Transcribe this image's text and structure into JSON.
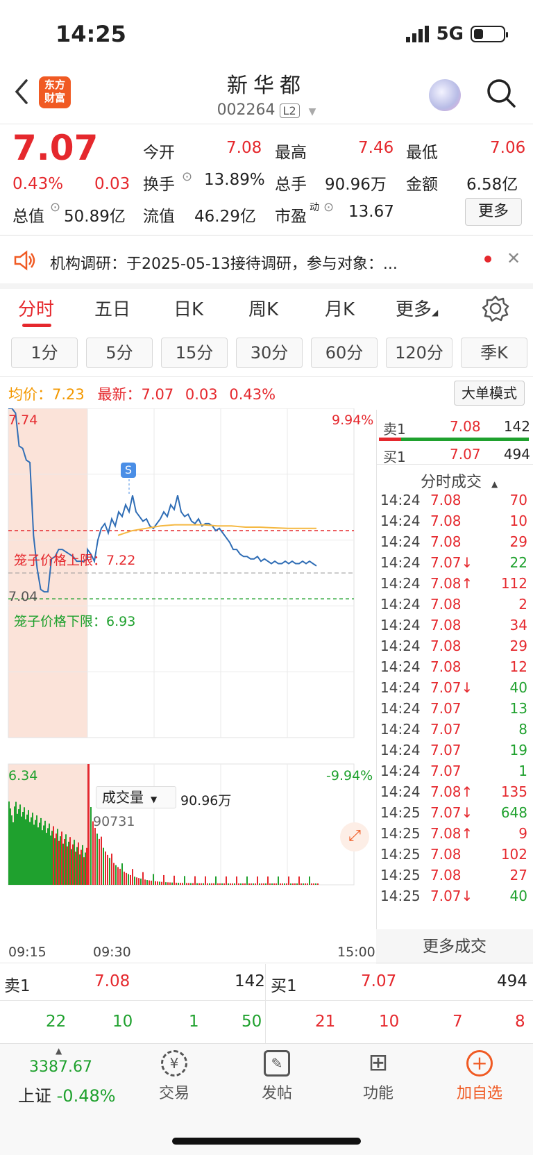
{
  "status_bar": {
    "time": "14:25",
    "network": "5G",
    "battery_level": 0.3
  },
  "header": {
    "title": "新华都",
    "code": "002264",
    "level_badge": "L2",
    "logo_text_1": "东方",
    "logo_text_2": "财富"
  },
  "quote": {
    "price": "7.07",
    "change_pct": "0.43%",
    "change": "0.03",
    "open_label": "今开",
    "open": "7.08",
    "high_label": "最高",
    "high": "7.46",
    "low_label": "最低",
    "low": "7.06",
    "turnover_label": "换手",
    "turnover": "13.89%",
    "volume_label": "总手",
    "volume": "90.96万",
    "amount_label": "金额",
    "amount": "6.58亿",
    "mcap_label": "总值",
    "mcap": "50.89亿",
    "float_label": "流值",
    "float_cap": "46.29亿",
    "pe_label": "市盈",
    "pe_sup": "动",
    "pe": "13.67",
    "more_button": "更多"
  },
  "notice": {
    "text": "机构调研：于2025-05-13接待调研，参与对象：..."
  },
  "period_tabs": [
    "分时",
    "五日",
    "日K",
    "周K",
    "月K",
    "更多"
  ],
  "kline_tabs": [
    "1分",
    "5分",
    "15分",
    "30分",
    "60分",
    "120分",
    "季K"
  ],
  "chart_header": {
    "avg_label": "均价：",
    "avg": "7.23",
    "latest_label": "最新：",
    "latest": "7.07",
    "latest_change": "0.03",
    "latest_pct": "0.43%",
    "big_order_button": "大单模式"
  },
  "chart_data": {
    "type": "line",
    "y_max": "7.74",
    "y_min": "6.34",
    "y_prev_close": "7.04",
    "pct_max": "9.94%",
    "pct_min": "-9.94%",
    "cage_upper_label": "笼子价格上限：7.22",
    "cage_lower_label": "笼子价格下限：6.93",
    "cage_upper": 7.22,
    "cage_lower": 6.93,
    "signal_badge": "S",
    "x_labels": [
      "09:15",
      "09:30",
      "15:00"
    ],
    "volume_label": "成交量",
    "volume_total": "90.96万",
    "volume_peak": "90731",
    "price_series": [
      7.74,
      7.74,
      7.72,
      7.58,
      7.57,
      7.52,
      7.51,
      7.2,
      7.06,
      6.97,
      6.96,
      6.96,
      7.1,
      7.11,
      7.14,
      7.14,
      7.13,
      7.12,
      7.11,
      7.09,
      7.09,
      7.09,
      7.1,
      7.14,
      7.12,
      7.09,
      7.18,
      7.23,
      7.25,
      7.21,
      7.27,
      7.24,
      7.3,
      7.28,
      7.33,
      7.3,
      7.37,
      7.3,
      7.28,
      7.26,
      7.27,
      7.24,
      7.23,
      7.25,
      7.27,
      7.3,
      7.28,
      7.33,
      7.31,
      7.37,
      7.3,
      7.28,
      7.29,
      7.26,
      7.25,
      7.27,
      7.24,
      7.25,
      7.25,
      7.24,
      7.22,
      7.23,
      7.21,
      7.19,
      7.17,
      7.14,
      7.14,
      7.12,
      7.11,
      7.11,
      7.1,
      7.1,
      7.11,
      7.09,
      7.1,
      7.09,
      7.08,
      7.09,
      7.08,
      7.08,
      7.09,
      7.08,
      7.09,
      7.08,
      7.08,
      7.09,
      7.08,
      7.09,
      7.08,
      7.07
    ],
    "avg_series": [
      7.2,
      7.22,
      7.23,
      7.24,
      7.245,
      7.245,
      7.245,
      7.24,
      7.24,
      7.235,
      7.235,
      7.232,
      7.23,
      7.23,
      7.23
    ]
  },
  "order_book_right": {
    "sell_label": "卖1",
    "sell_price": "7.08",
    "sell_vol": "142",
    "buy_label": "买1",
    "buy_price": "7.07",
    "buy_vol": "494"
  },
  "trades_header": "分时成交",
  "trades": [
    {
      "t": "14:24",
      "p": "7.08",
      "arrow": "",
      "v": "70",
      "c": "red"
    },
    {
      "t": "14:24",
      "p": "7.08",
      "arrow": "",
      "v": "10",
      "c": "red"
    },
    {
      "t": "14:24",
      "p": "7.08",
      "arrow": "",
      "v": "29",
      "c": "red"
    },
    {
      "t": "14:24",
      "p": "7.07",
      "arrow": "↓",
      "v": "22",
      "c": "green"
    },
    {
      "t": "14:24",
      "p": "7.08",
      "arrow": "↑",
      "v": "112",
      "c": "red"
    },
    {
      "t": "14:24",
      "p": "7.08",
      "arrow": "",
      "v": "2",
      "c": "red"
    },
    {
      "t": "14:24",
      "p": "7.08",
      "arrow": "",
      "v": "34",
      "c": "red"
    },
    {
      "t": "14:24",
      "p": "7.08",
      "arrow": "",
      "v": "29",
      "c": "red"
    },
    {
      "t": "14:24",
      "p": "7.08",
      "arrow": "",
      "v": "12",
      "c": "red"
    },
    {
      "t": "14:24",
      "p": "7.07",
      "arrow": "↓",
      "v": "40",
      "c": "green"
    },
    {
      "t": "14:24",
      "p": "7.07",
      "arrow": "",
      "v": "13",
      "c": "green"
    },
    {
      "t": "14:24",
      "p": "7.07",
      "arrow": "",
      "v": "8",
      "c": "green"
    },
    {
      "t": "14:24",
      "p": "7.07",
      "arrow": "",
      "v": "19",
      "c": "green"
    },
    {
      "t": "14:24",
      "p": "7.07",
      "arrow": "",
      "v": "1",
      "c": "green"
    },
    {
      "t": "14:24",
      "p": "7.08",
      "arrow": "↑",
      "v": "135",
      "c": "red"
    },
    {
      "t": "14:25",
      "p": "7.07",
      "arrow": "↓",
      "v": "648",
      "c": "green"
    },
    {
      "t": "14:25",
      "p": "7.08",
      "arrow": "↑",
      "v": "9",
      "c": "red"
    },
    {
      "t": "14:25",
      "p": "7.08",
      "arrow": "",
      "v": "102",
      "c": "red"
    },
    {
      "t": "14:25",
      "p": "7.08",
      "arrow": "",
      "v": "27",
      "c": "red"
    },
    {
      "t": "14:25",
      "p": "7.07",
      "arrow": "↓",
      "v": "40",
      "c": "green"
    }
  ],
  "more_trades_button": "更多成交",
  "bottom_book": {
    "sell_label": "卖1",
    "sell_price": "7.08",
    "sell_vol": "142",
    "buy_label": "买1",
    "buy_price": "7.07",
    "buy_vol": "494",
    "sell_queue": [
      "22",
      "10",
      "1",
      "50"
    ],
    "buy_queue": [
      "21",
      "10",
      "7",
      "8"
    ]
  },
  "index": {
    "value": "3387.67",
    "name": "上证",
    "change": "-0.48%"
  },
  "nav": {
    "trade": "交易",
    "post": "发帖",
    "func": "功能",
    "watch": "加自选"
  },
  "colors": {
    "up": "#e5282d",
    "down": "#1fa12e",
    "avg": "#f5b841",
    "line": "#2f6db5",
    "auction_bg": "#fbe3d9"
  }
}
